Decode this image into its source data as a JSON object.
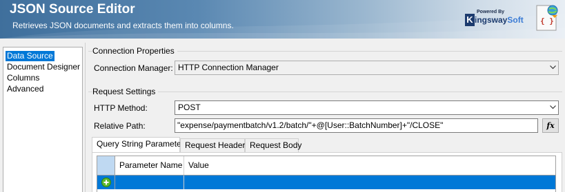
{
  "header": {
    "title": "JSON Source Editor",
    "subtitle": "Retrieves JSON documents and extracts them into columns.",
    "brand_powered": "Powered By",
    "brand_k": "K",
    "brand_name_a": "ingsway",
    "brand_name_b": "Soft"
  },
  "nav": {
    "items": [
      {
        "label": "Data Source",
        "selected": true
      },
      {
        "label": "Document Designer",
        "selected": false
      },
      {
        "label": "Columns",
        "selected": false
      },
      {
        "label": "Advanced",
        "selected": false
      }
    ]
  },
  "connection": {
    "group_label": "Connection Properties",
    "manager_label": "Connection Manager:",
    "manager_value": "HTTP Connection Manager"
  },
  "request": {
    "group_label": "Request Settings",
    "method_label": "HTTP Method:",
    "method_value": "POST",
    "path_label": "Relative Path:",
    "path_value": "\"expense/paymentbatch/v1.2/batch/\"+@[User::BatchNumber]+\"/CLOSE\"",
    "fx_label": "fx"
  },
  "tabs": [
    {
      "label": "Query String Parameters",
      "active": true
    },
    {
      "label": "Request Headers",
      "active": false
    },
    {
      "label": "Request Body",
      "active": false
    }
  ],
  "grid": {
    "columns": [
      "Parameter Name",
      "Value"
    ],
    "new_row_icon": "add-row-icon"
  },
  "colors": {
    "accent": "#0078d7",
    "header_dark": "#3f6f9c",
    "add_icon": "#5cb82e"
  }
}
